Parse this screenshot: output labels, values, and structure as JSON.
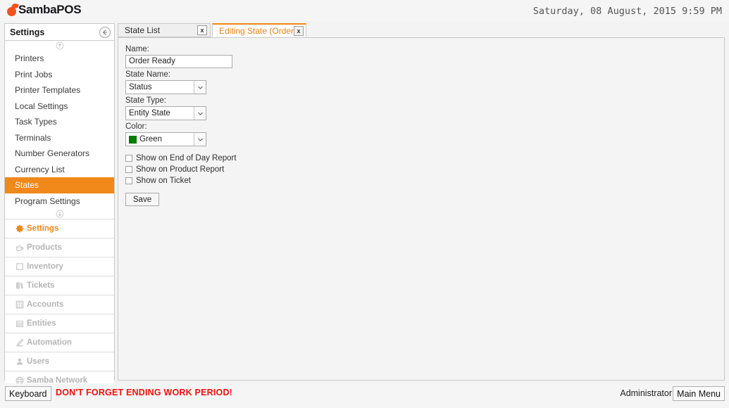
{
  "header": {
    "logo_text": "SambaPOS",
    "clock": "Saturday, 08 August, 2015 9:59 PM"
  },
  "sidebar": {
    "title": "Settings",
    "back_icon": "back-arrow-icon",
    "scroll_up_icon": "scroll-up-icon",
    "scroll_down_icon": "scroll-down-icon",
    "items": [
      {
        "label": "Printers",
        "active": false
      },
      {
        "label": "Print Jobs",
        "active": false
      },
      {
        "label": "Printer Templates",
        "active": false
      },
      {
        "label": "Local Settings",
        "active": false
      },
      {
        "label": "Task Types",
        "active": false
      },
      {
        "label": "Terminals",
        "active": false
      },
      {
        "label": "Number Generators",
        "active": false
      },
      {
        "label": "Currency List",
        "active": false
      },
      {
        "label": "States",
        "active": true
      },
      {
        "label": "Program Settings",
        "active": false
      }
    ],
    "modules": [
      {
        "label": "Settings",
        "icon": "gear-icon",
        "active": true
      },
      {
        "label": "Products",
        "icon": "coffee-cup-icon",
        "active": false
      },
      {
        "label": "Inventory",
        "icon": "box-icon",
        "active": false
      },
      {
        "label": "Tickets",
        "icon": "books-icon",
        "active": false
      },
      {
        "label": "Accounts",
        "icon": "calculator-icon",
        "active": false
      },
      {
        "label": "Entities",
        "icon": "building-icon",
        "active": false
      },
      {
        "label": "Automation",
        "icon": "pencil-icon",
        "active": false
      },
      {
        "label": "Users",
        "icon": "person-icon",
        "active": false
      },
      {
        "label": "Samba Network",
        "icon": "globe-icon",
        "active": false
      }
    ],
    "accent_color": "#f0881a"
  },
  "tabs": [
    {
      "label": "State List",
      "close": "x",
      "active": false
    },
    {
      "label": "Editing State (Order R",
      "close": "x",
      "active": true
    }
  ],
  "form": {
    "name_label": "Name:",
    "name_value": "Order Ready",
    "state_name_label": "State Name:",
    "state_name_value": "Status",
    "state_type_label": "State Type:",
    "state_type_value": "Entity State",
    "color_label": "Color:",
    "color_value": "Green",
    "color_hex": "#008000",
    "checkboxes": [
      {
        "label": "Show on End of Day Report",
        "checked": false
      },
      {
        "label": "Show on Product Report",
        "checked": false
      },
      {
        "label": "Show on Ticket",
        "checked": false
      }
    ],
    "save_label": "Save"
  },
  "footer": {
    "keyboard_label": "Keyboard",
    "warning": "DON'T FORGET ENDING WORK PERIOD!",
    "warning_color": "#ee1111",
    "user": "Administrator",
    "main_menu_label": "Main Menu"
  }
}
